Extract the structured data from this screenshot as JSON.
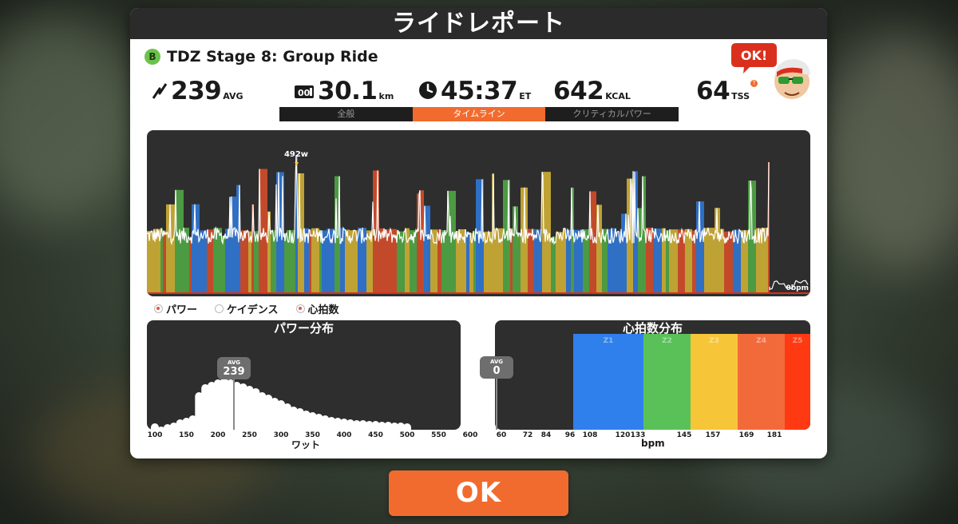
{
  "header": {
    "title": "ライドレポート"
  },
  "ride": {
    "badge": "B",
    "title": "TDZ Stage 8: Group Ride"
  },
  "stats": {
    "power": {
      "value": "239",
      "unit": "AVG"
    },
    "distance": {
      "value": "30.1",
      "unit": "km"
    },
    "time": {
      "value": "45:37",
      "unit": "ET"
    },
    "calories": {
      "value": "642",
      "unit": "KCAL"
    },
    "tss": {
      "value": "64",
      "unit": "TSS",
      "help": "?"
    }
  },
  "mascot": {
    "speech": "OK!"
  },
  "tabs": [
    {
      "label": "全般",
      "active": false
    },
    {
      "label": "タイムライン",
      "active": true
    },
    {
      "label": "クリティカルパワー",
      "active": false
    }
  ],
  "timeline": {
    "peak_label": "492w",
    "end_label": "0bpm"
  },
  "legend": [
    {
      "label": "パワー",
      "checked": true
    },
    {
      "label": "ケイデンス",
      "checked": false
    },
    {
      "label": "心拍数",
      "checked": true
    }
  ],
  "power_dist": {
    "title": "パワー分布",
    "avg_label": "AVG",
    "avg_value": "239",
    "x_ticks": [
      "100",
      "150",
      "200",
      "250",
      "300",
      "350",
      "400",
      "450",
      "500",
      "550",
      "600"
    ],
    "x_label": "ワット"
  },
  "hr_dist": {
    "title": "心拍数分布",
    "avg_label": "AVG",
    "avg_value": "0",
    "x_ticks": [
      "60",
      "72",
      "84",
      "96",
      "108",
      "120",
      "133",
      "145",
      "157",
      "169",
      "181"
    ],
    "x_label": "bpm",
    "zones": [
      {
        "label": "Z1",
        "color": "#2f80ed"
      },
      {
        "label": "Z2",
        "color": "#59c158"
      },
      {
        "label": "Z3",
        "color": "#f6c638"
      },
      {
        "label": "Z4",
        "color": "#f36a3a"
      },
      {
        "label": "Z5",
        "color": "#ff3a12"
      }
    ]
  },
  "colors": {
    "accent": "#f26b2e",
    "zone_blue": "#2f6fc4",
    "zone_green": "#4c9a42",
    "zone_yellow": "#bfa234",
    "zone_red": "#c24a2a"
  },
  "ok_button": {
    "label": "OK"
  },
  "chart_data": [
    {
      "type": "bar",
      "title": "パワー分布",
      "xlabel": "ワット",
      "categories": [
        "100",
        "110",
        "120",
        "130",
        "140",
        "150",
        "160",
        "170",
        "180",
        "190",
        "200",
        "210",
        "220",
        "230",
        "240",
        "250",
        "260",
        "270",
        "280",
        "290",
        "300",
        "310",
        "320",
        "330",
        "340",
        "350",
        "360",
        "370",
        "380",
        "390",
        "400",
        "410",
        "420",
        "430",
        "440",
        "450",
        "460",
        "470",
        "480",
        "490",
        "500"
      ],
      "values": [
        8,
        4,
        7,
        9,
        13,
        15,
        18,
        47,
        57,
        60,
        63,
        65,
        63,
        60,
        58,
        55,
        52,
        47,
        44,
        40,
        37,
        33,
        29,
        27,
        24,
        22,
        20,
        18,
        16,
        15,
        14,
        13,
        12,
        12,
        11,
        11,
        10,
        10,
        9,
        9,
        8
      ]
    },
    {
      "type": "bar",
      "title": "心拍数分布",
      "xlabel": "bpm",
      "categories": [
        "Z1",
        "Z2",
        "Z3",
        "Z4",
        "Z5"
      ],
      "values": [
        100,
        100,
        100,
        100,
        100
      ]
    }
  ]
}
